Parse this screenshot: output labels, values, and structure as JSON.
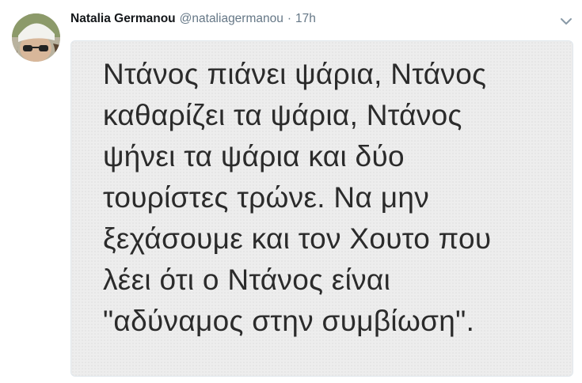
{
  "tweet": {
    "author": {
      "name": "Natalia Germanou",
      "handle": "@nataliagermanou"
    },
    "separator": "·",
    "timestamp": "17h",
    "icons": {
      "caret": "chevron-down-icon",
      "avatar": "avatar"
    },
    "media": {
      "lines": [
        "Ντάνος πιάνει ψάρια, Ντάνος",
        "καθαρίζει τα ψάρια, Ντάνος",
        "ψήνει τα ψάρια και δύο",
        "τουρίστες τρώνε. Να μην",
        "ξεχάσουμε και τον Χουτο που",
        "λέει ότι ο Ντάνος είναι",
        "\"αδύναμος στην συμβίωση\"."
      ]
    },
    "colors": {
      "name": "#14171a",
      "secondary": "#657786",
      "media_bg": "#ededed",
      "media_text": "#2b2b2b"
    }
  }
}
